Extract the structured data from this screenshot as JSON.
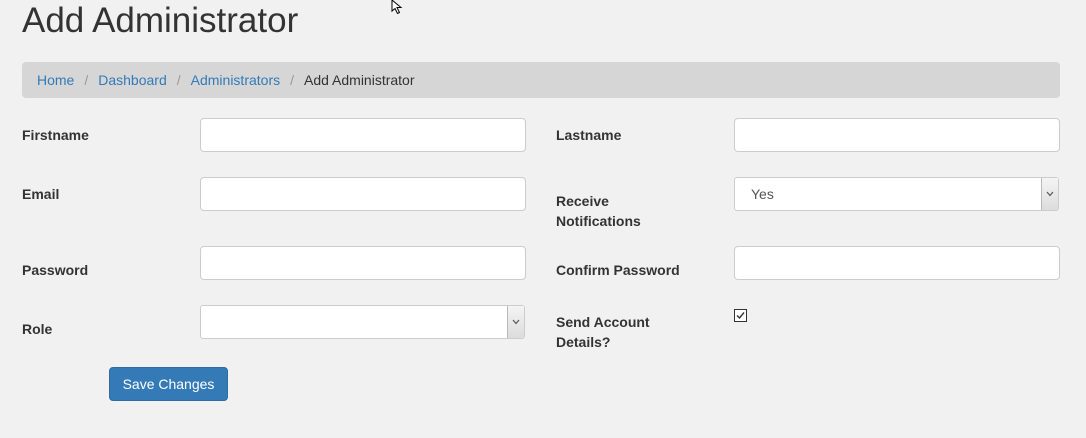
{
  "page": {
    "title": "Add Administrator"
  },
  "breadcrumb": {
    "items": [
      "Home",
      "Dashboard",
      "Administrators"
    ],
    "separator": "/",
    "active": "Add Administrator"
  },
  "form": {
    "firstname": {
      "label": "Firstname",
      "value": ""
    },
    "lastname": {
      "label": "Lastname",
      "value": ""
    },
    "email": {
      "label": "Email",
      "value": ""
    },
    "receive_notifications": {
      "label_line1": "Receive",
      "label_line2": "Notifications",
      "value": "Yes"
    },
    "password": {
      "label": "Password",
      "value": ""
    },
    "confirm_password": {
      "label": "Confirm Password",
      "value": ""
    },
    "role": {
      "label": "Role",
      "value": ""
    },
    "send_account_details": {
      "label_line1": "Send Account",
      "label_line2": "Details?",
      "checked": true
    },
    "save_label": "Save Changes"
  },
  "colors": {
    "link": "#337ab7",
    "primary_button": "#337ab7",
    "breadcrumb_bg": "#d6d6d6",
    "page_bg": "#f1f1f1"
  },
  "icons": {
    "cursor": "mouse-pointer-icon",
    "select_arrow": "chevron-down-icon",
    "checkbox": "checkmark-icon"
  }
}
